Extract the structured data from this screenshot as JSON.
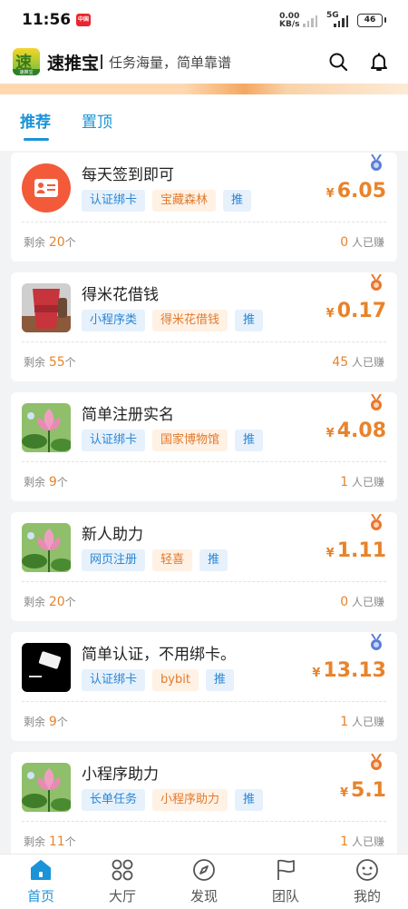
{
  "status_bar": {
    "time": "11:56",
    "sim_badge": "中国移动",
    "net_speed_value": "0.00",
    "net_speed_unit": "KB/s",
    "network": "5G",
    "battery": "46"
  },
  "header": {
    "app_name": "速推宝",
    "slogan": "任务海量，简单靠谱",
    "logo_text": "速",
    "logo_sub": "速推宝",
    "search_icon": "search-icon",
    "bell_icon": "bell-icon"
  },
  "tabs": [
    {
      "label": "推荐",
      "active": true
    },
    {
      "label": "置顶",
      "active": false
    }
  ],
  "tasks": [
    {
      "title": "每天签到即可",
      "tags": [
        "认证绑卡",
        "宝藏森林",
        "推"
      ],
      "currency": "¥",
      "price": "6.05",
      "remain_label": "剩余",
      "remain": "20",
      "unit": "个",
      "earned": "0",
      "earned_label": "人已赚",
      "medal": "blue",
      "thumb": "id-card"
    },
    {
      "title": "得米花借钱",
      "tags": [
        "小程序类",
        "得米花借钱",
        "推"
      ],
      "currency": "¥",
      "price": "0.17",
      "remain_label": "剩余",
      "remain": "55",
      "unit": "个",
      "earned": "45",
      "earned_label": "人已赚",
      "medal": "orange",
      "thumb": "coffee"
    },
    {
      "title": "简单注册实名",
      "tags": [
        "认证绑卡",
        "国家博物馆",
        "推"
      ],
      "currency": "¥",
      "price": "4.08",
      "remain_label": "剩余",
      "remain": "9",
      "unit": "个",
      "earned": "1",
      "earned_label": "人已赚",
      "medal": "orange",
      "thumb": "lotus"
    },
    {
      "title": "新人助力",
      "tags": [
        "网页注册",
        "轻喜",
        "推"
      ],
      "currency": "¥",
      "price": "1.11",
      "remain_label": "剩余",
      "remain": "20",
      "unit": "个",
      "earned": "0",
      "earned_label": "人已赚",
      "medal": "orange",
      "thumb": "lotus"
    },
    {
      "title": "简单认证，不用绑卡。",
      "tags": [
        "认证绑卡",
        "bybit",
        "推"
      ],
      "currency": "¥",
      "price": "13.13",
      "remain_label": "剩余",
      "remain": "9",
      "unit": "个",
      "earned": "1",
      "earned_label": "人已赚",
      "medal": "blue",
      "thumb": "card"
    },
    {
      "title": "小程序助力",
      "tags": [
        "长单任务",
        "小程序助力",
        "推"
      ],
      "currency": "¥",
      "price": "5.1",
      "remain_label": "剩余",
      "remain": "11",
      "unit": "个",
      "earned": "1",
      "earned_label": "人已赚",
      "medal": "orange",
      "thumb": "lotus"
    }
  ],
  "nav": [
    {
      "label": "首页",
      "icon": "home-icon",
      "active": true
    },
    {
      "label": "大厅",
      "icon": "grid-icon",
      "active": false
    },
    {
      "label": "发现",
      "icon": "compass-icon",
      "active": false
    },
    {
      "label": "团队",
      "icon": "flag-icon",
      "active": false
    },
    {
      "label": "我的",
      "icon": "smile-icon",
      "active": false
    }
  ],
  "colors": {
    "accent": "#1a93d9",
    "price": "#e8832a",
    "tag_blue_bg": "#e6f1fc",
    "tag_orange_bg": "#fff1e4"
  }
}
